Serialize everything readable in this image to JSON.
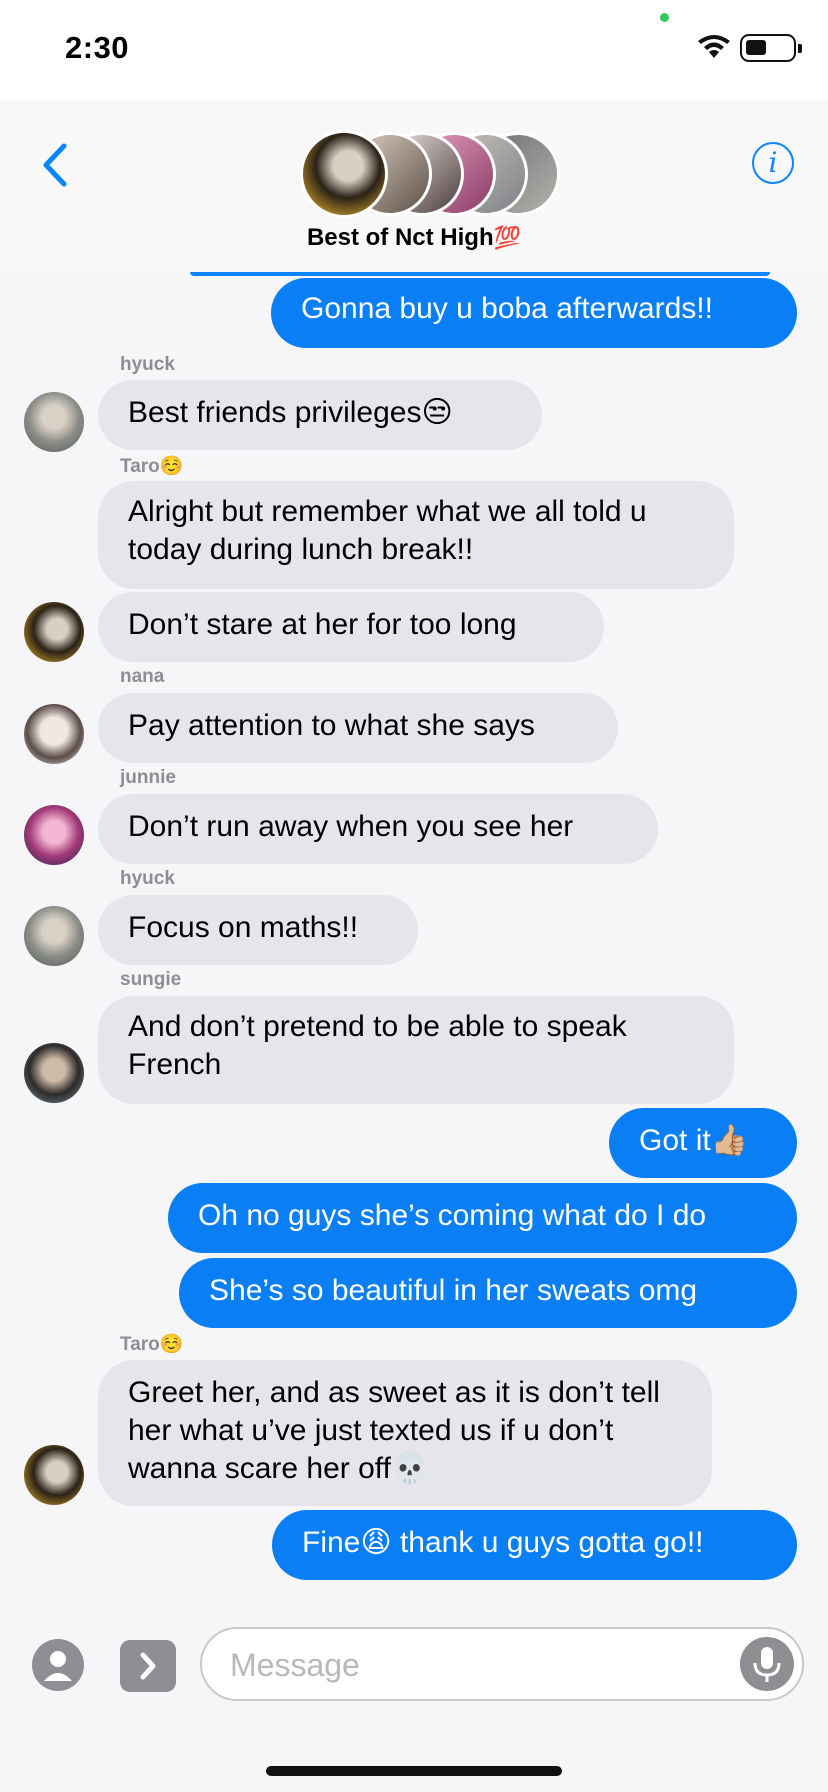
{
  "status": {
    "time": "2:30"
  },
  "header": {
    "group_name": "Best of Nct High",
    "group_emoji": "💯",
    "info_glyph": "i"
  },
  "messages": [
    {
      "type": "sent",
      "text": "Gonna buy u boba afterwards!!"
    },
    {
      "type": "recv",
      "sender": "hyuck",
      "text": "Best friends privileges😒"
    },
    {
      "type": "recv",
      "sender": "Taro☺️",
      "text": "Alright but remember what we all told u today during lunch break!!"
    },
    {
      "type": "recv",
      "text": "Don’t stare at her for too long"
    },
    {
      "type": "recv",
      "sender": "nana",
      "text": "Pay attention to what she says"
    },
    {
      "type": "recv",
      "sender": "junnie",
      "text": "Don’t run away when you see her"
    },
    {
      "type": "recv",
      "sender": "hyuck",
      "text": "Focus on maths!!"
    },
    {
      "type": "recv",
      "sender": "sungie",
      "text": "And don’t pretend to be able to speak French"
    },
    {
      "type": "sent",
      "text": "Got it👍🏼"
    },
    {
      "type": "sent",
      "text": "Oh no guys she’s coming what do I do"
    },
    {
      "type": "sent",
      "text": "She’s so beautiful in her sweats omg"
    },
    {
      "type": "recv",
      "sender": "Taro☺️",
      "text": "Greet her, and as sweet as it is don’t tell her what u’ve just texted us if u don’t wanna scare her off💀"
    },
    {
      "type": "sent",
      "text": "Fine😩 thank u guys gotta go!!"
    }
  ],
  "input": {
    "placeholder": "Message"
  },
  "colors": {
    "sent": "#0a7ff5",
    "received": "#e6e5eb",
    "accent": "#0a84ff"
  },
  "icons": [
    "back-chevron-icon",
    "info-icon",
    "camera-icon",
    "apps-icon",
    "microphone-icon",
    "wifi-icon",
    "battery-icon"
  ]
}
